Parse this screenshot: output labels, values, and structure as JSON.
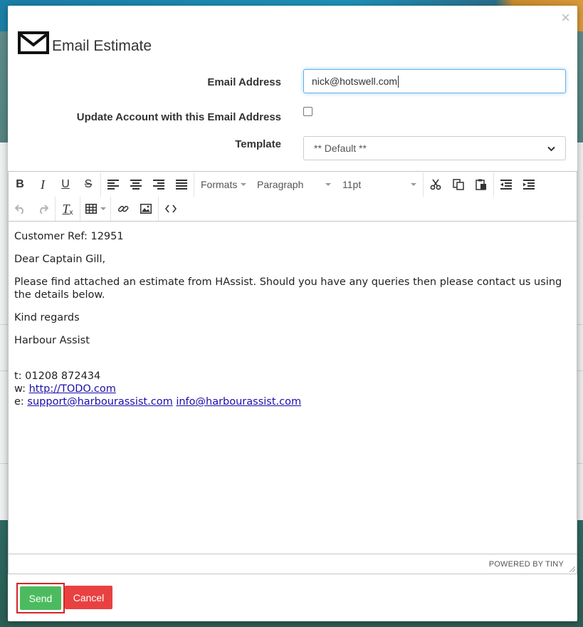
{
  "modal": {
    "title": "Email Estimate",
    "close_label": "×"
  },
  "form": {
    "email_label": "Email Address",
    "email_value": "nick@hotswell.com",
    "update_label": "Update Account with this Email Address",
    "update_checked": false,
    "template_label": "Template",
    "template_value": "** Default **"
  },
  "toolbar": {
    "formats": "Formats",
    "block": "Paragraph",
    "font_size": "11pt"
  },
  "body": {
    "customer_ref": "Customer Ref: 12951",
    "greeting": "Dear Captain Gill,",
    "message": "Please find attached an estimate from HAssist. Should you have any queries then please contact us using the details below.",
    "signoff": "Kind regards",
    "company": "Harbour Assist",
    "phone": "t: 01208 872434",
    "web_prefix": "w: ",
    "web_link": "http://TODO.com",
    "email_prefix": "e: ",
    "email_link_1": "support@harbourassist.com",
    "email_link_2": "info@harbourassist.com"
  },
  "status_bar": {
    "powered_by": "POWERED BY TINY"
  },
  "footer": {
    "send_label": "Send",
    "cancel_label": "Cancel"
  },
  "colors": {
    "send": "#4cbb60",
    "cancel": "#e94141",
    "highlight": "#d62424",
    "input_focus": "#66afe9"
  }
}
